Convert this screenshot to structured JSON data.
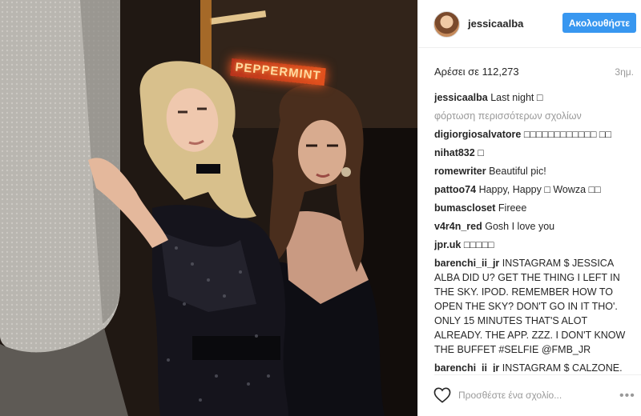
{
  "post": {
    "username": "jessicaalba",
    "follow_label": "Ακολουθήστε",
    "likes_text": "Αρέσει σε 112,273",
    "time_ago": "3ημ.",
    "neon_sign_text": "PEPPERMINT",
    "load_more_label": "φόρτωση περισσότερων σχολίων",
    "caption": {
      "user": "jessicaalba",
      "text": "Last night □"
    },
    "comments": [
      {
        "user": "digiorgiosalvatore",
        "text": "□□□□□□□□□□□□ □□"
      },
      {
        "user": "nihat832",
        "text": "□"
      },
      {
        "user": "romewriter",
        "text": "Beautiful pic!"
      },
      {
        "user": "pattoo74",
        "text": "Happy, Happy □ Wowza □□"
      },
      {
        "user": "bumascloset",
        "text": "Fireee"
      },
      {
        "user": "v4r4n_red",
        "text": "Gosh I love you"
      },
      {
        "user": "jpr.uk",
        "text": "□□□□□"
      },
      {
        "user": "barenchi_ii_jr",
        "text": "INSTAGRAM $ JESSICA ALBA DID U? GET THE THING I LEFT IN THE SKY. IPOD. REMEMBER HOW TO OPEN THE SKY? DON'T GO IN IT THO'. ONLY 15 MINUTES THAT'S ALOT ALREADY. THE APP. ZZZ. I DON'T KNOW THE BUFFET #SELFIE @FMB_JR"
      },
      {
        "user": "barenchi_ii_jr",
        "text": "INSTAGRAM $ CALZONE. ZHOP. I DON'T KNOW THE BUFFET"
      }
    ],
    "comment_placeholder": "Προσθέστε ένα σχολίο...",
    "more_glyph": "•••"
  },
  "colors": {
    "accent": "#3897f0",
    "muted": "#999999",
    "text": "#262626"
  }
}
